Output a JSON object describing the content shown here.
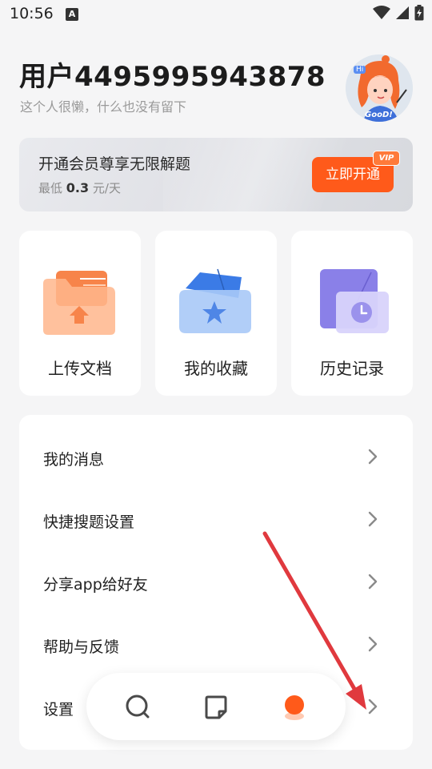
{
  "status_bar": {
    "time": "10:56",
    "a_label": "A"
  },
  "profile": {
    "username": "用户4495995943878",
    "bio": "这个人很懒，什么也没有留下",
    "avatar_text_hi": "Hi",
    "avatar_text_good": "GooD!"
  },
  "vip": {
    "title": "开通会员尊享无限解题",
    "price_prefix": "最低 ",
    "price_value": "0.3",
    "price_suffix": " 元/天",
    "button": "立即开通",
    "badge": "VIP"
  },
  "quick_actions": [
    {
      "label": "上传文档",
      "icon": "upload-folder-icon"
    },
    {
      "label": "我的收藏",
      "icon": "star-folder-icon"
    },
    {
      "label": "历史记录",
      "icon": "clock-history-icon"
    }
  ],
  "menu": [
    {
      "label": "我的消息"
    },
    {
      "label": "快捷搜题设置"
    },
    {
      "label": "分享app给好友"
    },
    {
      "label": "帮助与反馈"
    },
    {
      "label": "设置"
    }
  ],
  "tabbar": [
    {
      "icon": "search-icon"
    },
    {
      "icon": "notebook-icon"
    },
    {
      "icon": "profile-blob-icon"
    }
  ],
  "colors": {
    "accent": "#ff5a1a",
    "annotation_arrow": "#e0393e"
  }
}
